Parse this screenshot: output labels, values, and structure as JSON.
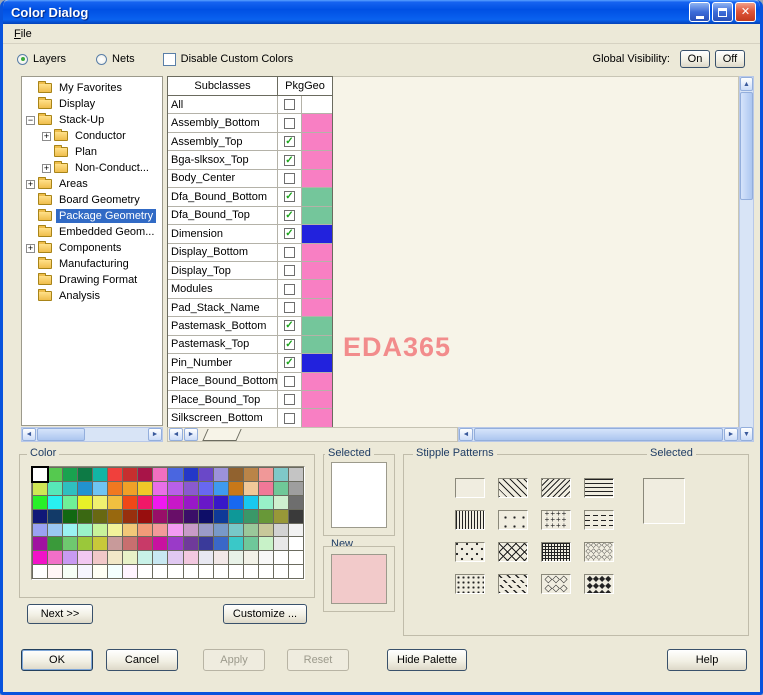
{
  "window": {
    "title": "Color Dialog",
    "menu_file": "File"
  },
  "controls": {
    "layers": "Layers",
    "nets": "Nets",
    "disable_custom": "Disable Custom Colors",
    "global_visibility": "Global Visibility:",
    "on": "On",
    "off": "Off"
  },
  "tree": {
    "items": [
      {
        "label": "My Favorites",
        "level": 1,
        "expander": "none",
        "selected": false
      },
      {
        "label": "Display",
        "level": 1,
        "expander": "none",
        "selected": false
      },
      {
        "label": "Stack-Up",
        "level": 1,
        "expander": "minus",
        "selected": false
      },
      {
        "label": "Conductor",
        "level": 2,
        "expander": "plus",
        "selected": false
      },
      {
        "label": "Plan",
        "level": 2,
        "expander": "none",
        "selected": false
      },
      {
        "label": "Non-Conduct...",
        "level": 2,
        "expander": "plus",
        "selected": false
      },
      {
        "label": "Areas",
        "level": 1,
        "expander": "plus",
        "selected": false
      },
      {
        "label": "Board Geometry",
        "level": 1,
        "expander": "none",
        "selected": false
      },
      {
        "label": "Package Geometry",
        "level": 1,
        "expander": "none",
        "selected": true
      },
      {
        "label": "Embedded Geom...",
        "level": 1,
        "expander": "none",
        "selected": false
      },
      {
        "label": "Components",
        "level": 1,
        "expander": "plus",
        "selected": false
      },
      {
        "label": "Manufacturing",
        "level": 1,
        "expander": "none",
        "selected": false
      },
      {
        "label": "Drawing Format",
        "level": 1,
        "expander": "none",
        "selected": false
      },
      {
        "label": "Analysis",
        "level": 1,
        "expander": "none",
        "selected": false
      }
    ]
  },
  "table": {
    "headers": [
      "Subclasses",
      "PkgGeo"
    ],
    "rows": [
      {
        "label": "All",
        "checked": false,
        "swatch": ""
      },
      {
        "label": "Assembly_Bottom",
        "checked": false,
        "swatch": "#F87FC3"
      },
      {
        "label": "Assembly_Top",
        "checked": true,
        "swatch": "#F87FC3"
      },
      {
        "label": "Bga-slksox_Top",
        "checked": true,
        "swatch": "#F87FC3"
      },
      {
        "label": "Body_Center",
        "checked": false,
        "swatch": "#F87FC3"
      },
      {
        "label": "Dfa_Bound_Bottom",
        "checked": true,
        "swatch": "#74C69B"
      },
      {
        "label": "Dfa_Bound_Top",
        "checked": true,
        "swatch": "#74C69B"
      },
      {
        "label": "Dimension",
        "checked": true,
        "swatch": "#2222DD"
      },
      {
        "label": "Display_Bottom",
        "checked": false,
        "swatch": "#F87FC3"
      },
      {
        "label": "Display_Top",
        "checked": false,
        "swatch": "#F87FC3"
      },
      {
        "label": "Modules",
        "checked": false,
        "swatch": "#F87FC3"
      },
      {
        "label": "Pad_Stack_Name",
        "checked": false,
        "swatch": "#F87FC3"
      },
      {
        "label": "Pastemask_Bottom",
        "checked": true,
        "swatch": "#74C69B"
      },
      {
        "label": "Pastemask_Top",
        "checked": true,
        "swatch": "#74C69B"
      },
      {
        "label": "Pin_Number",
        "checked": true,
        "swatch": "#2222DD"
      },
      {
        "label": "Place_Bound_Bottom",
        "checked": false,
        "swatch": "#F87FC3"
      },
      {
        "label": "Place_Bound_Top",
        "checked": false,
        "swatch": "#F87FC3"
      },
      {
        "label": "Silkscreen_Bottom",
        "checked": false,
        "swatch": "#F87FC3"
      }
    ]
  },
  "canvas": {
    "watermark": "EDA365"
  },
  "color_section": {
    "label": "Color",
    "selected_index": 0,
    "next_button": "Next >>",
    "customize_button": "Customize ...",
    "palette": [
      [
        "#FFFFFF",
        "#55C94F",
        "#19A24F",
        "#0D7A45",
        "#12B5A5",
        "#F0403C",
        "#C62F2F",
        "#A81448",
        "#F06FC0",
        "#4A66E0",
        "#2438C8",
        "#6A48C8",
        "#9C92DA",
        "#91622F",
        "#BA8448",
        "#F09898",
        "#7FC8C8",
        "#C4C4C4"
      ],
      [
        "#CFE755",
        "#57E8B8",
        "#2FBFBF",
        "#2292CF",
        "#6FC4F2",
        "#F07820",
        "#F0A028",
        "#F0C828",
        "#E86FE8",
        "#B860E8",
        "#8A5ACF",
        "#6868F0",
        "#3E9AF0",
        "#C87818",
        "#F0C898",
        "#F07898",
        "#6FC898",
        "#9E9E9E"
      ],
      [
        "#28F028",
        "#28F0F0",
        "#6FF098",
        "#E8F028",
        "#F0F06F",
        "#F0C040",
        "#F04818",
        "#F01868",
        "#F018F0",
        "#C818C8",
        "#9818C8",
        "#6818C8",
        "#3818C8",
        "#1868F0",
        "#18C8F0",
        "#98F0C8",
        "#CFF0CF",
        "#6E6E6E"
      ],
      [
        "#101878",
        "#123A68",
        "#126812",
        "#3A6812",
        "#686812",
        "#98680E",
        "#98300E",
        "#980E0E",
        "#980E68",
        "#680E68",
        "#3A0E68",
        "#0E0E68",
        "#0E3A98",
        "#0E9898",
        "#3A9868",
        "#689838",
        "#989838",
        "#3A3A3A"
      ],
      [
        "#9AA2F2",
        "#9AC8F2",
        "#9AF2F2",
        "#9AF2C8",
        "#C8F29A",
        "#F2F29A",
        "#F2C878",
        "#F29A78",
        "#F29A9A",
        "#F29AF2",
        "#C89AC8",
        "#9A9AC8",
        "#7899C8",
        "#78C8C8",
        "#9AC89A",
        "#C8C89A",
        "#D2D2D2",
        "#F2F2F2"
      ],
      [
        "#A012A0",
        "#3A9A3A",
        "#6FC86F",
        "#9AC83A",
        "#C8C83A",
        "#C89A9A",
        "#C86F6F",
        "#C83A68",
        "#C812A0",
        "#9A3AC8",
        "#6F3A9A",
        "#3A3A9A",
        "#3A68C8",
        "#3AC8C8",
        "#6FC89A",
        "#C8F2C8",
        "#E8E8E8",
        "#FFFFFF"
      ],
      [
        "#F212C8",
        "#F26FC8",
        "#C89AF2",
        "#F2C8F2",
        "#F2C8C8",
        "#F2E8C8",
        "#E8F2C8",
        "#C8F2E8",
        "#C8E8F2",
        "#E0C8F2",
        "#F2C8E0",
        "#E8E8F2",
        "#F2E8E8",
        "#E8F2E8",
        "#F2F2E8",
        "#F8F8F8",
        "#FFFFFF",
        "#FFFFFF"
      ],
      [
        "#FFFFFF",
        "#FFF6F6",
        "#F6FFF6",
        "#F6F6FF",
        "#FFFFF4",
        "#F4FFFF",
        "#FFF4FF",
        "#FFFFFF",
        "#FFFFFF",
        "#FFFFFF",
        "#FFFFFF",
        "#FFFFFF",
        "#FFFFFF",
        "#FFFFFF",
        "#FFFFFF",
        "#FFFFFF",
        "#FFFFFF",
        "#FFFFFF"
      ]
    ]
  },
  "selected_section": {
    "label": "Selected",
    "current_color": "#FFFFFF",
    "new_label": "New",
    "new_color": "#F2CACA"
  },
  "stipple_section": {
    "label": "Stipple Patterns",
    "selected_label": "Selected",
    "selected_pattern": "solid",
    "patterns": [
      {
        "name": "solid",
        "style": "solid"
      },
      {
        "name": "diagonal-backslash-lines",
        "style": "diagb"
      },
      {
        "name": "diagonal-slash-lines",
        "style": "diagf"
      },
      {
        "name": "horizontal-lines",
        "style": "hlines"
      },
      {
        "name": "vertical-lines",
        "style": "vlines"
      },
      {
        "name": "sparse-dots",
        "style": "dotsparse"
      },
      {
        "name": "plus-dots",
        "style": "plus",
        "glyph": "+"
      },
      {
        "name": "horizontal-dashes",
        "style": "hdash"
      },
      {
        "name": "scattered-dots",
        "style": "dotscatter"
      },
      {
        "name": "diamond-lattice",
        "style": "dialat"
      },
      {
        "name": "fine-grid",
        "style": "grid"
      },
      {
        "name": "small-diamonds",
        "style": "smdia",
        "glyph": "◇"
      },
      {
        "name": "dense-dots",
        "style": "dotdense"
      },
      {
        "name": "diagonal-dashes",
        "style": "diagdash"
      },
      {
        "name": "cross-hatch-diamonds",
        "style": "xhatch",
        "glyph": "◇"
      },
      {
        "name": "solid-diamonds",
        "style": "soldia",
        "glyph": "◆"
      }
    ]
  },
  "footer": {
    "ok": "OK",
    "cancel": "Cancel",
    "apply": "Apply",
    "reset": "Reset",
    "hide_palette": "Hide Palette",
    "help": "Help"
  },
  "colors": {
    "selection_blue": "#316AC5",
    "subclass_pink": "#F87FC3",
    "subclass_green": "#74C69B",
    "subclass_blue": "#2222DD",
    "watermark_pink": "#F28C8C",
    "titlebar_blue": "#0853DD"
  }
}
